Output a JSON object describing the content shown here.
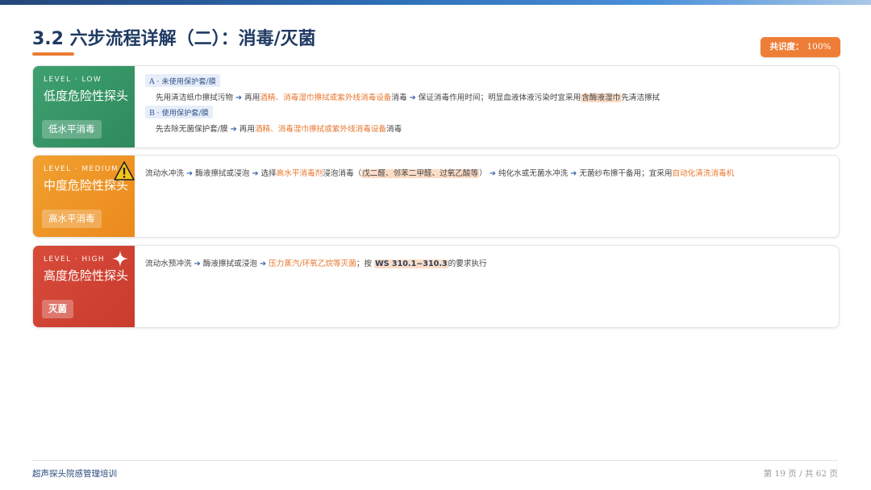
{
  "title": "3.2 六步流程详解（二）：消毒/灭菌",
  "badge": {
    "label": "共识度：",
    "value": "100%"
  },
  "colors": {
    "low": "#3a9a6a",
    "medium": "#ee9526",
    "high": "#d2463a",
    "accent": "#ea7d35",
    "title": "#1f3a63"
  },
  "cards": {
    "low": {
      "level": "LEVEL · LOW",
      "title": "低度危险性探头",
      "pill": "低水平消毒",
      "a_tag": "A · 未使用保护套/膜",
      "a_1": "先用清洁纸巾擦拭污物",
      "a_2": "再用",
      "a_3": "酒精、消毒湿巾擦拭或紫外线消毒设备",
      "a_4": "消毒",
      "a_5": "保证消毒作用时间；明显血液体液污染时宜采用",
      "a_6": "含酶液湿巾",
      "a_7": "先清洁擦拭",
      "b_tag": "B · 使用保护套/膜",
      "b_1": "先去除无菌保护套/膜",
      "b_2": "再用",
      "b_3": "酒精、消毒湿巾擦拭或紫外线消毒设备",
      "b_4": "消毒"
    },
    "medium": {
      "level": "LEVEL · MEDIUM",
      "title": "中度危险性探头",
      "pill": "高水平消毒",
      "icon": "warning-icon",
      "t1": "流动水冲洗",
      "t2": "酶液擦拭或浸泡",
      "t3": "选择",
      "t4": "高水平消毒剂",
      "t5": "浸泡消毒（",
      "t6": "戊二醛、邻苯二甲醛、过氧乙酸等",
      "t7": "）",
      "t8": "纯化水或无菌水冲洗",
      "t9": "无菌纱布擦干备用；宜采用",
      "t10": "自动化清洗消毒机"
    },
    "high": {
      "level": "LEVEL · HIGH",
      "title": "高度危险性探头",
      "pill": "灭菌",
      "icon": "sparkle-icon",
      "t1": "流动水预冲洗",
      "t2": "酶液擦拭或浸泡",
      "t3": "压力蒸汽/环氧乙烷等灭菌",
      "t4": "；按",
      "t5": "WS 310.1~310.3",
      "t6": "的要求执行"
    }
  },
  "arrow": "➔",
  "footer": {
    "left": "超声探头院感管理培训",
    "right": "第 19 页 / 共 62 页"
  }
}
